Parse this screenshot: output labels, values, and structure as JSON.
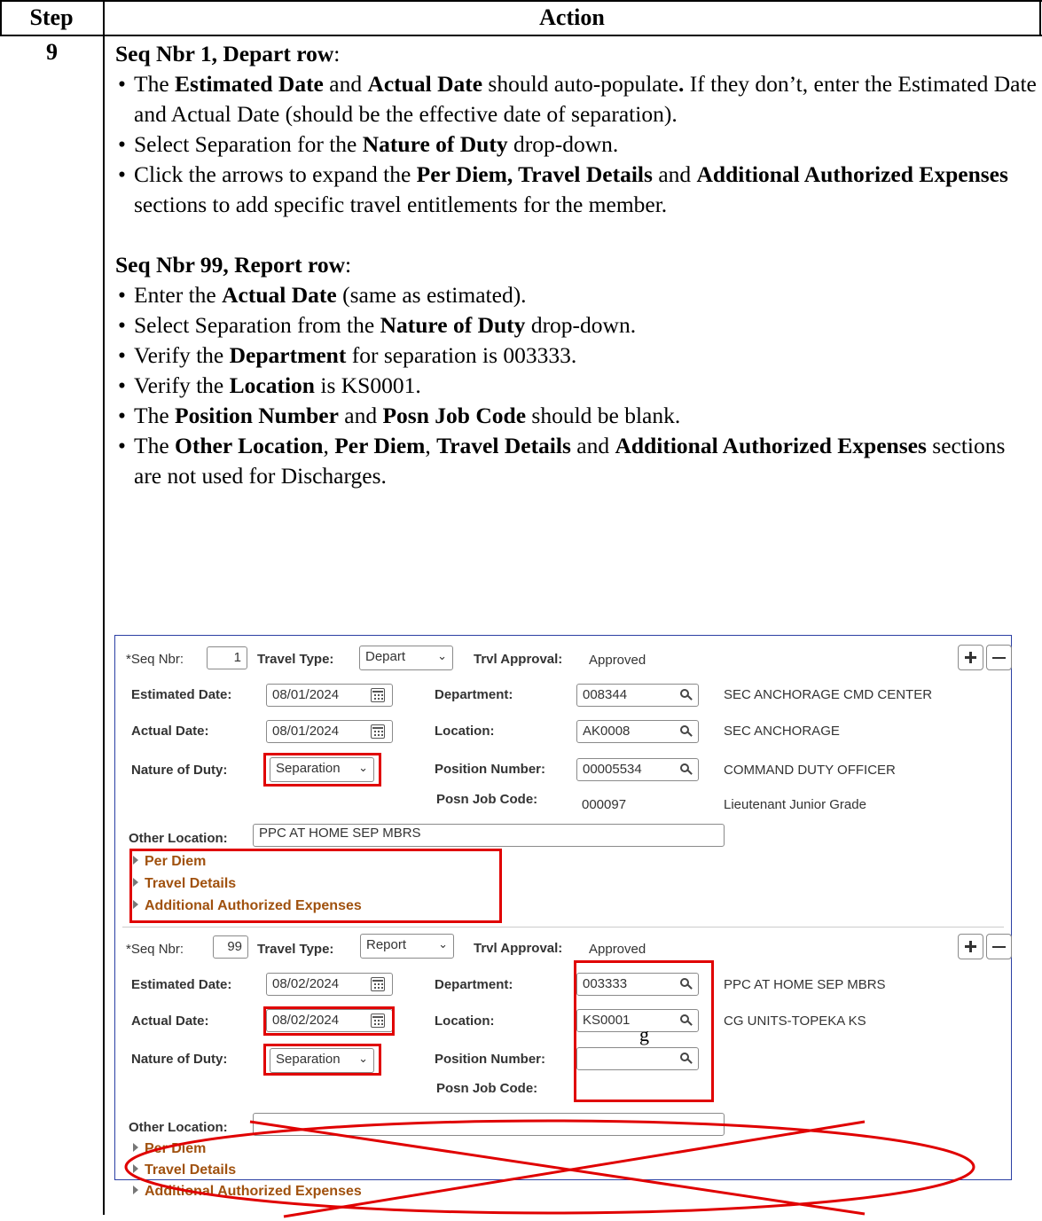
{
  "table": {
    "col_step": "Step",
    "col_action": "Action",
    "step_number": "9"
  },
  "instructions": {
    "depart_heading": "Seq Nbr 1, Depart row",
    "depart_colon": ":",
    "report_heading": "Seq Nbr 99, Report row",
    "report_colon": ":",
    "b1_a": "The ",
    "b1_b": "Estimated Date",
    "b1_c": " and ",
    "b1_d": "Actual Date",
    "b1_e": " should auto-populate",
    "b1_f": ".",
    "b1_g": " If they don’t, enter the Estimated Date and Actual Date (should be the effective date of separation).",
    "b2_a": "Select Separation for the ",
    "b2_b": "Nature of Duty",
    "b2_c": " drop-down.",
    "b3_a": "Click the arrows to expand the ",
    "b3_b": "Per Diem, Travel Details",
    "b3_c": " and ",
    "b3_d": "Additional Authorized Expenses",
    "b3_e": " sections to add specific travel entitlements for the member.",
    "b4_a": "Enter the ",
    "b4_b": "Actual Date",
    "b4_c": " (same as estimated).",
    "b5_a": "Select Separation from the ",
    "b5_b": "Nature of Duty",
    "b5_c": " drop-down.",
    "b6_a": "Verify the ",
    "b6_b": "Department",
    "b6_c": " for separation is 003333.",
    "b7_a": "Verify the ",
    "b7_b": "Location",
    "b7_c": " is KS0001.",
    "b8_a": "The ",
    "b8_b": "Position Number",
    "b8_c": " and ",
    "b8_d": "Posn Job Code",
    "b8_e": " should be blank.",
    "b9_a": "The ",
    "b9_b": "Other Location",
    "b9_c": ", ",
    "b9_d": "Per Diem",
    "b9_e": ", ",
    "b9_f": "Travel Details",
    "b9_g": " and ",
    "b9_h": "Additional Authorized Expenses",
    "b9_i": " sections are not used for Discharges."
  },
  "form_labels": {
    "seq_nbr": "*Seq Nbr:",
    "travel_type": "Travel Type:",
    "trvl_approval": "Trvl Approval:",
    "estimated_date": "Estimated Date:",
    "actual_date": "Actual Date:",
    "nature_of_duty": "Nature of Duty:",
    "department": "Department:",
    "location": "Location:",
    "position_number": "Position Number:",
    "posn_job_code": "Posn Job Code:",
    "other_location": "Other Location:",
    "per_diem": "Per Diem",
    "travel_details": "Travel Details",
    "additional_expenses": "Additional Authorized Expenses"
  },
  "rows": [
    {
      "seq_nbr": "1",
      "travel_type": "Depart",
      "trvl_approval": "Approved",
      "estimated_date": "08/01/2024",
      "actual_date": "08/01/2024",
      "nature_of_duty": "Separation",
      "department": "008344",
      "department_desc": "SEC ANCHORAGE CMD CENTER",
      "location": "AK0008",
      "location_desc": "SEC ANCHORAGE",
      "position_number": "00005534",
      "position_desc": "COMMAND DUTY OFFICER",
      "posn_job_code": "000097",
      "posn_job_desc": "Lieutenant Junior Grade",
      "other_location": "PPC AT HOME SEP MBRS"
    },
    {
      "seq_nbr": "99",
      "travel_type": "Report",
      "trvl_approval": "Approved",
      "estimated_date": "08/02/2024",
      "actual_date": "08/02/2024",
      "nature_of_duty": "Separation",
      "department": "003333",
      "department_desc": "PPC AT HOME SEP MBRS",
      "location": "KS0001",
      "location_desc": "CG UNITS-TOPEKA KS",
      "position_number": "",
      "other_location": "",
      "stray_mark": "g"
    }
  ],
  "colors": {
    "highlight_red": "#e00000",
    "link_brown": "#a0510e",
    "frame_blue": "#2b3fa3"
  }
}
